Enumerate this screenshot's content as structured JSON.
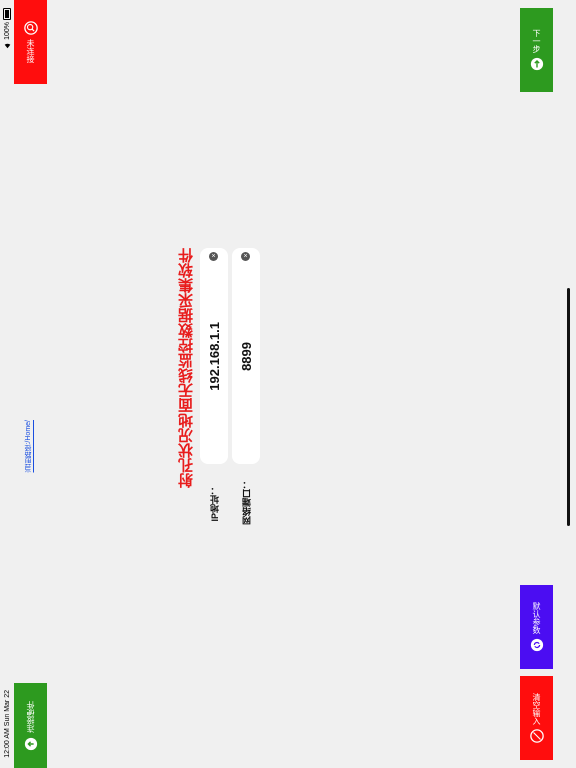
{
  "status": {
    "time_date": "12:00 AM   Sun Mar 22",
    "battery": "100%"
  },
  "buttons": {
    "disconnected": "未连接",
    "connect_hardware": "连接硬件",
    "next_step": "下一步",
    "default_params": "默认参数",
    "clear_input": "清空输入"
  },
  "current_path": "当前路径:/Home/",
  "title": "射孔状况地面无线监控数据采集软件",
  "fields": {
    "ip_label": "IP地址：",
    "ip_value": "192.168.1.1",
    "port_label": "网络端口：",
    "port_value": "8899"
  },
  "colors": {
    "red": "#ff0d0d",
    "green": "#2d9a1f",
    "purple": "#4b0df2",
    "title_red": "#e81c1c"
  },
  "icons": {
    "disconnected": "search-icon",
    "connect": "arrow-down-circle-icon",
    "next": "arrow-up-circle-icon",
    "default": "refresh-icon",
    "clear": "no-entry-icon",
    "field_clear": "clear-x-icon"
  }
}
